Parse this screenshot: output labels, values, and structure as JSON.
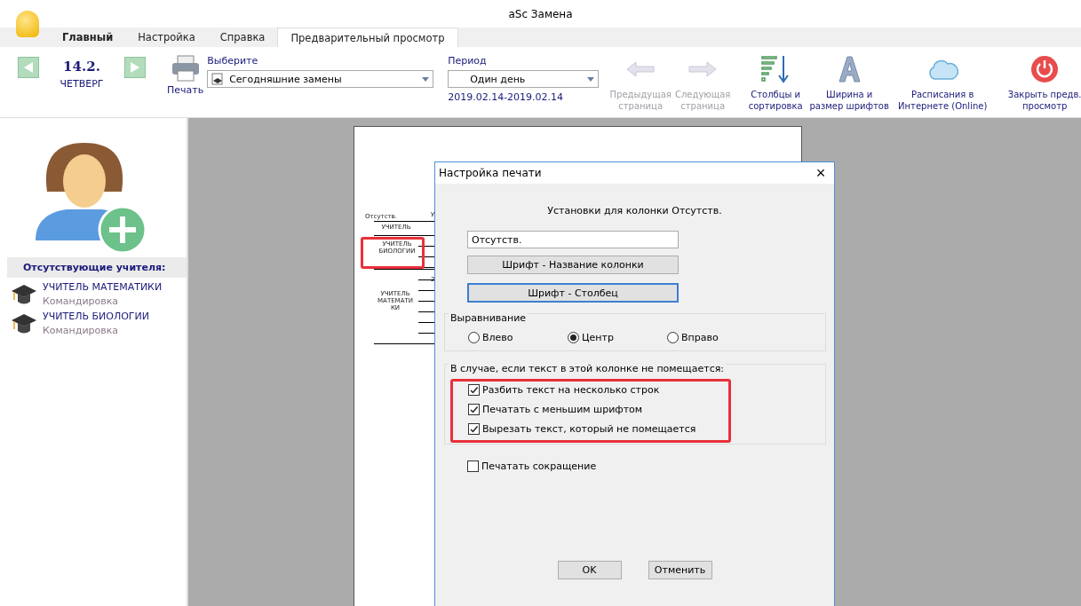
{
  "window": {
    "title": "aSc Замена"
  },
  "tabs": [
    {
      "label": "Главный",
      "selected": false,
      "bold": true
    },
    {
      "label": "Настройка",
      "selected": false,
      "bold": false
    },
    {
      "label": "Справка",
      "selected": false,
      "bold": false
    },
    {
      "label": "Предварительный просмотр",
      "selected": true,
      "bold": false
    }
  ],
  "date": {
    "day": "14.2.",
    "weekday": "ЧЕТВЕРГ"
  },
  "print_button": "Печать",
  "select": {
    "label": "Выберите",
    "value": "Сегодняшние замены"
  },
  "period": {
    "label": "Период",
    "value": "Один день",
    "range": "2019.02.14-2019.02.14"
  },
  "toolbar": [
    {
      "kind": "prev",
      "label": "Предыдущая страница",
      "disabled": true
    },
    {
      "kind": "next",
      "label": "Следующая страница",
      "disabled": true
    },
    {
      "kind": "columns",
      "label": "Столбцы и сортировка",
      "disabled": false
    },
    {
      "kind": "font",
      "label": "Ширина и размер шрифтов",
      "disabled": false
    },
    {
      "kind": "cloud",
      "label": "Расписания в Интернете (Online)",
      "disabled": false
    },
    {
      "kind": "power",
      "label": "Закрыть предв. просмотр",
      "disabled": false
    }
  ],
  "absent": {
    "heading": "Отсутствующие учителя:",
    "teachers": [
      {
        "name": "УЧИТЕЛЬ МАТЕМАТИКИ",
        "reason": "Командировка"
      },
      {
        "name": "УЧИТЕЛЬ БИОЛОГИИ",
        "reason": "Командировка"
      }
    ]
  },
  "preview": {
    "column_header": "Отсутств.",
    "cut_header": "У",
    "cells": [
      "УЧИТЕЛЬ",
      "УЧИТЕЛЬ БИОЛОГИИ",
      "2",
      "УЧИТЕЛЬ МАТЕМАТИ КИ"
    ]
  },
  "dialog": {
    "title": "Настройка печати",
    "close": "×",
    "heading": "Установки для колонки Отсутств.",
    "column_name": "Отсутств.",
    "buttons": [
      {
        "label": "Шрифт - Название колонки",
        "focused": false
      },
      {
        "label": "Шрифт - Столбец",
        "focused": true
      }
    ],
    "alignment": {
      "label": "Выравнивание",
      "options": [
        {
          "label": "Влево",
          "selected": false
        },
        {
          "label": "Центр",
          "selected": true
        },
        {
          "label": "Вправо",
          "selected": false
        }
      ]
    },
    "overflow": {
      "label": "В случае, если текст в этой колонке не помещается:",
      "options": [
        {
          "label": "Разбить текст на несколько строк",
          "checked": true
        },
        {
          "label": "Печатать с меньшим шрифтом",
          "checked": true
        },
        {
          "label": "Вырезать текст, который не помещается",
          "checked": true
        }
      ]
    },
    "abbrev": {
      "label": "Печатать сокращение",
      "checked": false
    },
    "ok": "OK",
    "cancel": "Отменить"
  }
}
